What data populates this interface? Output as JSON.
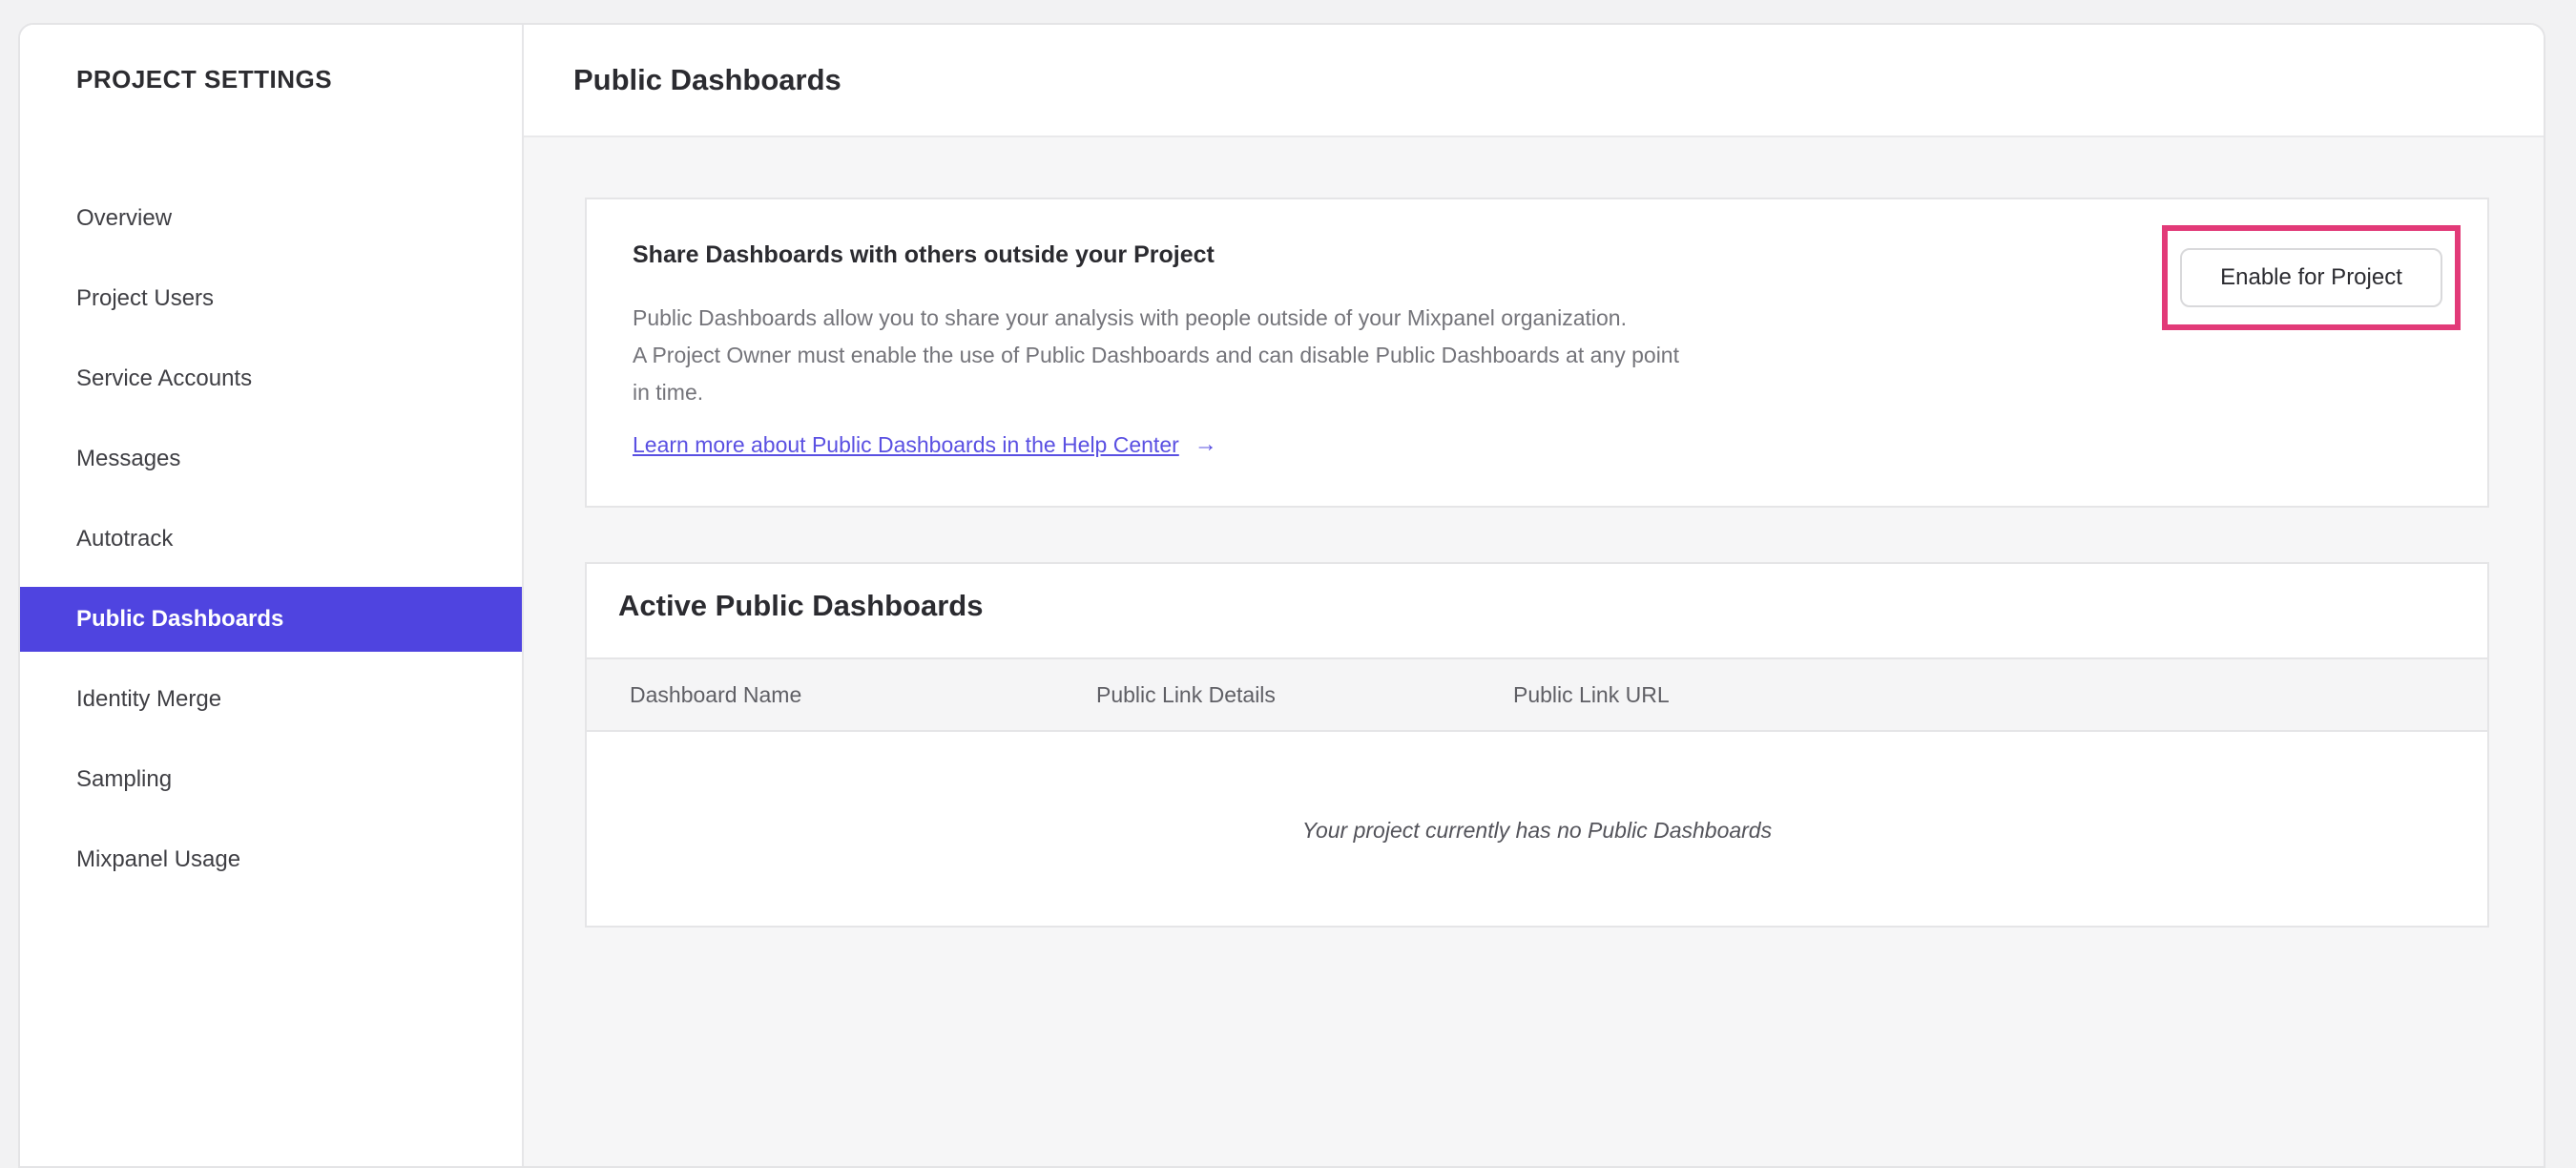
{
  "sidebar": {
    "title": "PROJECT SETTINGS",
    "items": [
      {
        "label": "Overview",
        "selected": false
      },
      {
        "label": "Project Users",
        "selected": false
      },
      {
        "label": "Service Accounts",
        "selected": false
      },
      {
        "label": "Messages",
        "selected": false
      },
      {
        "label": "Autotrack",
        "selected": false
      },
      {
        "label": "Public Dashboards",
        "selected": true
      },
      {
        "label": "Identity Merge",
        "selected": false
      },
      {
        "label": "Sampling",
        "selected": false
      },
      {
        "label": "Mixpanel Usage",
        "selected": false
      }
    ]
  },
  "header": {
    "title": "Public Dashboards"
  },
  "share_card": {
    "heading": "Share Dashboards with others outside your Project",
    "description_lines": [
      "Public Dashboards allow you to share your analysis with people outside of your Mixpanel organization.",
      "A Project Owner must enable the use of Public Dashboards and can disable Public Dashboards at any point",
      "in time."
    ],
    "link_label": "Learn more about Public Dashboards in the Help Center",
    "link_arrow": "→",
    "enable_button_label": "Enable for Project"
  },
  "dashboards_card": {
    "heading": "Active Public Dashboards",
    "columns": [
      "Dashboard Name",
      "Public Link Details",
      "Public Link URL"
    ],
    "empty_message": "Your project currently has no Public Dashboards"
  },
  "colors": {
    "accent_purple": "#4f44e0",
    "link_purple": "#5a50e2",
    "highlight_pink": "#e23a78"
  }
}
